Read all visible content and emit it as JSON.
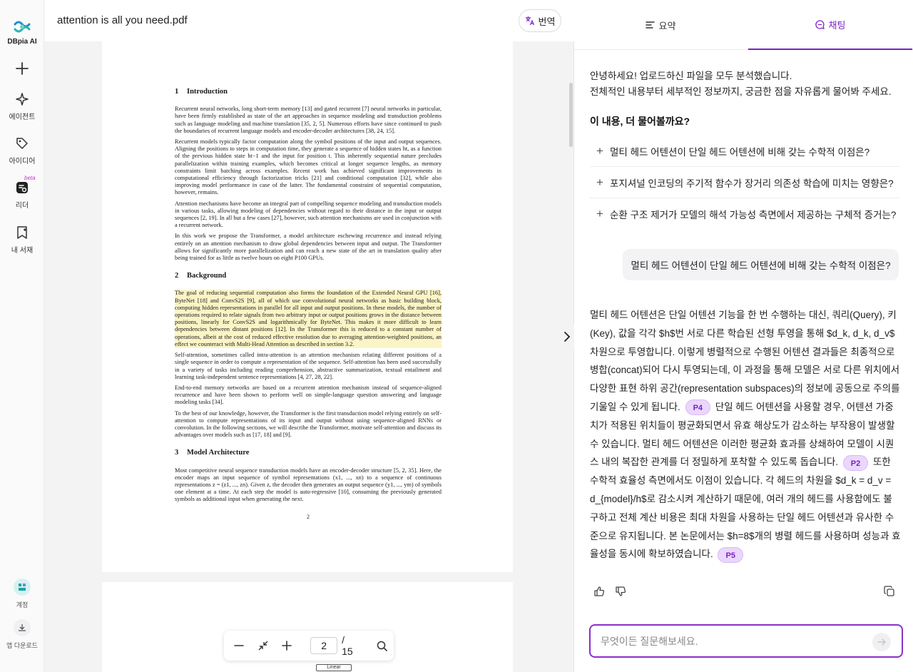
{
  "sidebar": {
    "brand": "DBpia AI",
    "items": [
      {
        "label": ""
      },
      {
        "label": "에이전트"
      },
      {
        "label": "아이디어"
      },
      {
        "label": "리더",
        "badge": "beta"
      },
      {
        "label": "내 서재"
      }
    ],
    "account_label": "계정",
    "download_label": "앱 다운로드"
  },
  "document": {
    "title": "attention is all you need.pdf",
    "translate_label": "번역",
    "current_page": "2",
    "total_pages": "/ 15",
    "mode_tag": "Linear",
    "content": {
      "s1_num": "1",
      "s1_title": "Introduction",
      "p1": "Recurrent neural networks, long short-term memory [13] and gated recurrent [7] neural networks in particular, have been firmly established as state of the art approaches in sequence modeling and transduction problems such as language modeling and machine translation [35, 2, 5]. Numerous efforts have since continued to push the boundaries of recurrent language models and encoder-decoder architectures [38, 24, 15].",
      "p2": "Recurrent models typically factor computation along the symbol positions of the input and output sequences. Aligning the positions to steps in computation time, they generate a sequence of hidden states ht, as a function of the previous hidden state ht−1 and the input for position t. This inherently sequential nature precludes parallelization within training examples, which becomes critical at longer sequence lengths, as memory constraints limit batching across examples. Recent work has achieved significant improvements in computational efficiency through factorization tricks [21] and conditional computation [32], while also improving model performance in case of the latter. The fundamental constraint of sequential computation, however, remains.",
      "p3": "Attention mechanisms have become an integral part of compelling sequence modeling and transduction models in various tasks, allowing modeling of dependencies without regard to their distance in the input or output sequences [2, 19]. In all but a few cases [27], however, such attention mechanisms are used in conjunction with a recurrent network.",
      "p4": "In this work we propose the Transformer, a model architecture eschewing recurrence and instead relying entirely on an attention mechanism to draw global dependencies between input and output. The Transformer allows for significantly more parallelization and can reach a new state of the art in translation quality after being trained for as little as twelve hours on eight P100 GPUs.",
      "s2_num": "2",
      "s2_title": "Background",
      "p5": "The goal of reducing sequential computation also forms the foundation of the Extended Neural GPU [16], ByteNet [18] and ConvS2S [9], all of which use convolutional neural networks as basic building block, computing hidden representations in parallel for all input and output positions. In these models, the number of operations required to relate signals from two arbitrary input or output positions grows in the distance between positions, linearly for ConvS2S and logarithmically for ByteNet. This makes it more difficult to learn dependencies between distant positions [12]. In the Transformer this is reduced to a constant number of operations, albeit at the cost of reduced effective resolution due to averaging attention-weighted positions, an effect we counteract with Multi-Head Attention as described in section 3.2.",
      "p6": "Self-attention, sometimes called intra-attention is an attention mechanism relating different positions of a single sequence in order to compute a representation of the sequence. Self-attention has been used successfully in a variety of tasks including reading comprehension, abstractive summarization, textual entailment and learning task-independent sentence representations [4, 27, 28, 22].",
      "p7": "End-to-end memory networks are based on a recurrent attention mechanism instead of sequence-aligned recurrence and have been shown to perform well on simple-language question answering and language modeling tasks [34].",
      "p8": "To the best of our knowledge, however, the Transformer is the first transduction model relying entirely on self-attention to compute representations of its input and output without using sequence-aligned RNNs or convolution. In the following sections, we will describe the Transformer, motivate self-attention and discuss its advantages over models such as [17, 18] and [9].",
      "s3_num": "3",
      "s3_title": "Model Architecture",
      "p9": "Most competitive neural sequence transduction models have an encoder-decoder structure [5, 2, 35]. Here, the encoder maps an input sequence of symbol representations (x1, ..., xn) to a sequence of continuous representations z = (z1, ..., zn). Given z, the decoder then generates an output sequence (y1, ..., ym) of symbols one element at a time. At each step the model is auto-regressive [10], consuming the previously generated symbols as additional input when generating the next.",
      "page_number": "2"
    }
  },
  "panel": {
    "tabs": [
      {
        "label": "요약"
      },
      {
        "label": "채팅"
      }
    ],
    "greeting_line1": "안녕하세요! 업로드하신 파일을 모두 분석했습니다.",
    "greeting_line2": "전체적인 내용부터 세부적인 정보까지, 궁금한 점을 자유롭게 물어봐 주세요.",
    "suggest_title": "이 내용, 더 물어볼까요?",
    "suggestions": [
      "멀티 헤드 어텐션이 단일 헤드 어텐션에 비해 갖는 수학적 이점은?",
      "포지셔널 인코딩의 주기적 함수가 장거리 의존성 학습에 미치는 영향은?",
      "순환 구조 제거가 모델의 해석 가능성 측면에서 제공하는 구체적 증거는?"
    ],
    "user_message": "멀티 헤드 어텐션이 단일 헤드 어텐션에 비해 갖는 수학적 이점은?",
    "answer": {
      "part1": "멀티 헤드 어텐션은 단일 어텐션 기능을 한 번 수행하는 대신, 쿼리(Query), 키(Key), 값을 각각 $h$번 서로 다른 학습된 선형 투영을 통해 $d_k, d_k, d_v$ 차원으로 투영합니다. 이렇게 병렬적으로 수행된 어텐션 결과들은 최종적으로 병합(concat)되어 다시 투영되는데, 이 과정을 통해 모델은 서로 다른 위치에서 다양한 표현 하위 공간(representation subspaces)의 정보에 공동으로 주의를 기울일 수 있게 됩니다.",
      "chip1": "P4",
      "part2": "단일 헤드 어텐션을 사용할 경우, 어텐션 가중치가 적용된 위치들이 평균화되면서 유효 해상도가 감소하는 부작용이 발생할 수 있습니다. 멀티 헤드 어텐션은 이러한 평균화 효과를 상쇄하여 모델이 시퀀스 내의 복잡한 관계를 더 정밀하게 포착할 수 있도록 돕습니다.",
      "chip2": "P2",
      "part3": "또한 수학적 효율성 측면에서도 이점이 있습니다. 각 헤드의 차원을 $d_k = d_v = d_{model}/h$로 감소시켜 계산하기 때문에, 여러 개의 헤드를 사용함에도 불구하고 전체 계산 비용은 최대 차원을 사용하는 단일 헤드 어텐션과 유사한 수준으로 유지됩니다. 본 논문에서는 $h=8$개의 병렬 헤드를 사용하며 성능과 효율성을 동시에 확보하였습니다.",
      "chip3": "P5"
    },
    "input_placeholder": "무엇이든 질문해보세요."
  },
  "colors": {
    "accent": "#7b22c4",
    "highlight": "#fbf4c6",
    "chip_bg": "#ead7fb"
  },
  "icons": [
    "brand-logo-icon",
    "plus-icon",
    "sparkle-icon",
    "tag-icon",
    "reader-icon",
    "bookmark-icon",
    "account-icon",
    "download-icon",
    "translate-icon",
    "zoom-out-icon",
    "fit-icon",
    "zoom-in-icon",
    "search-icon",
    "chevron-right-icon",
    "list-icon",
    "chat-bubble-icon",
    "thumbs-up-icon",
    "thumbs-down-icon",
    "copy-icon",
    "send-arrow-icon"
  ]
}
